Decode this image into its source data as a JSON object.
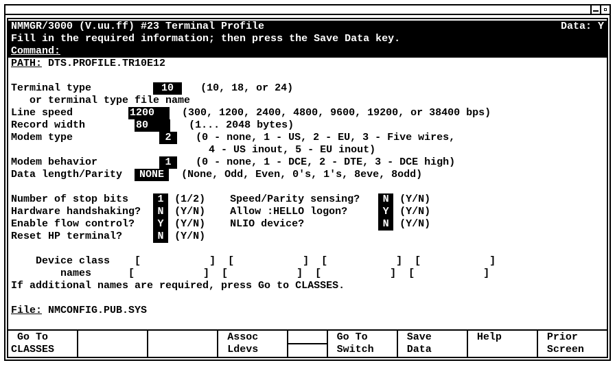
{
  "header": {
    "title_left": "NMMGR/3000 (V.uu.ff) #23 Terminal Profile",
    "title_right": "Data: Y",
    "instruction": "Fill in the required information; then press the Save Data key.",
    "command_label": "Command:"
  },
  "path": {
    "label": "PATH:",
    "value": "DTS.PROFILE.TR10E12"
  },
  "fields": {
    "terminal_type": {
      "label": "Terminal type",
      "value": "10",
      "hint": "(10, 18, or 24)"
    },
    "terminal_file": {
      "label": "or terminal type file name",
      "value": ""
    },
    "line_speed": {
      "label": "Line speed",
      "value": "1200",
      "hint": "(300, 1200, 2400, 4800, 9600, 19200, or 38400 bps)"
    },
    "record_width": {
      "label": "Record width",
      "value": "80",
      "hint": "(1... 2048 bytes)"
    },
    "modem_type": {
      "label": "Modem type",
      "value": "2",
      "hint1": "(0 - none, 1 - US, 2 - EU, 3 - Five wires,",
      "hint2": " 4 - US inout, 5 - EU inout)"
    },
    "modem_behavior": {
      "label": "Modem behavior",
      "value": "1",
      "hint": "(0 - none, 1 - DCE, 2 - DTE, 3 - DCE high)"
    },
    "data_length_parity": {
      "label": "Data length/Parity",
      "value": "NONE",
      "hint": "(None, Odd, Even, 0's, 1's, 8eve, 8odd)"
    },
    "stop_bits": {
      "label": "Number of stop bits",
      "value": "1",
      "hint": "(1/2)"
    },
    "speed_parity": {
      "label": "Speed/Parity sensing?",
      "value": "N",
      "hint": "(Y/N)"
    },
    "hw_handshake": {
      "label": "Hardware handshaking?",
      "value": "N",
      "hint": "(Y/N)"
    },
    "hello_logon": {
      "label": "Allow :HELLO logon?",
      "value": "Y",
      "hint": "(Y/N)"
    },
    "flow_control": {
      "label": "Enable flow control?",
      "value": "Y",
      "hint": "(Y/N)"
    },
    "nlio_device": {
      "label": "NLIO device?",
      "value": "N",
      "hint": "(Y/N)"
    },
    "reset_hp": {
      "label": "Reset HP terminal?",
      "value": "N",
      "hint": "(Y/N)"
    },
    "device_class": {
      "label1": "Device class",
      "label2": "names",
      "values": [
        "",
        "",
        "",
        "",
        "",
        "",
        "",
        ""
      ]
    },
    "extra_names_msg": "If additional names are required, press Go to CLASSES."
  },
  "file": {
    "label": "File:",
    "value": "NMCONFIG.PUB.SYS"
  },
  "softkeys": {
    "f1": {
      "l1": " Go To",
      "l2": "CLASSES"
    },
    "f2": {
      "l1": "",
      "l2": ""
    },
    "f3": {
      "l1": "",
      "l2": ""
    },
    "f4": {
      "l1": " Assoc",
      "l2": " Ldevs"
    },
    "f5": {
      "l1": " Go To",
      "l2": " Switch"
    },
    "f6": {
      "l1": " Save",
      "l2": " Data"
    },
    "f7": {
      "l1": " Help",
      "l2": ""
    },
    "f8": {
      "l1": " Prior",
      "l2": " Screen"
    }
  }
}
